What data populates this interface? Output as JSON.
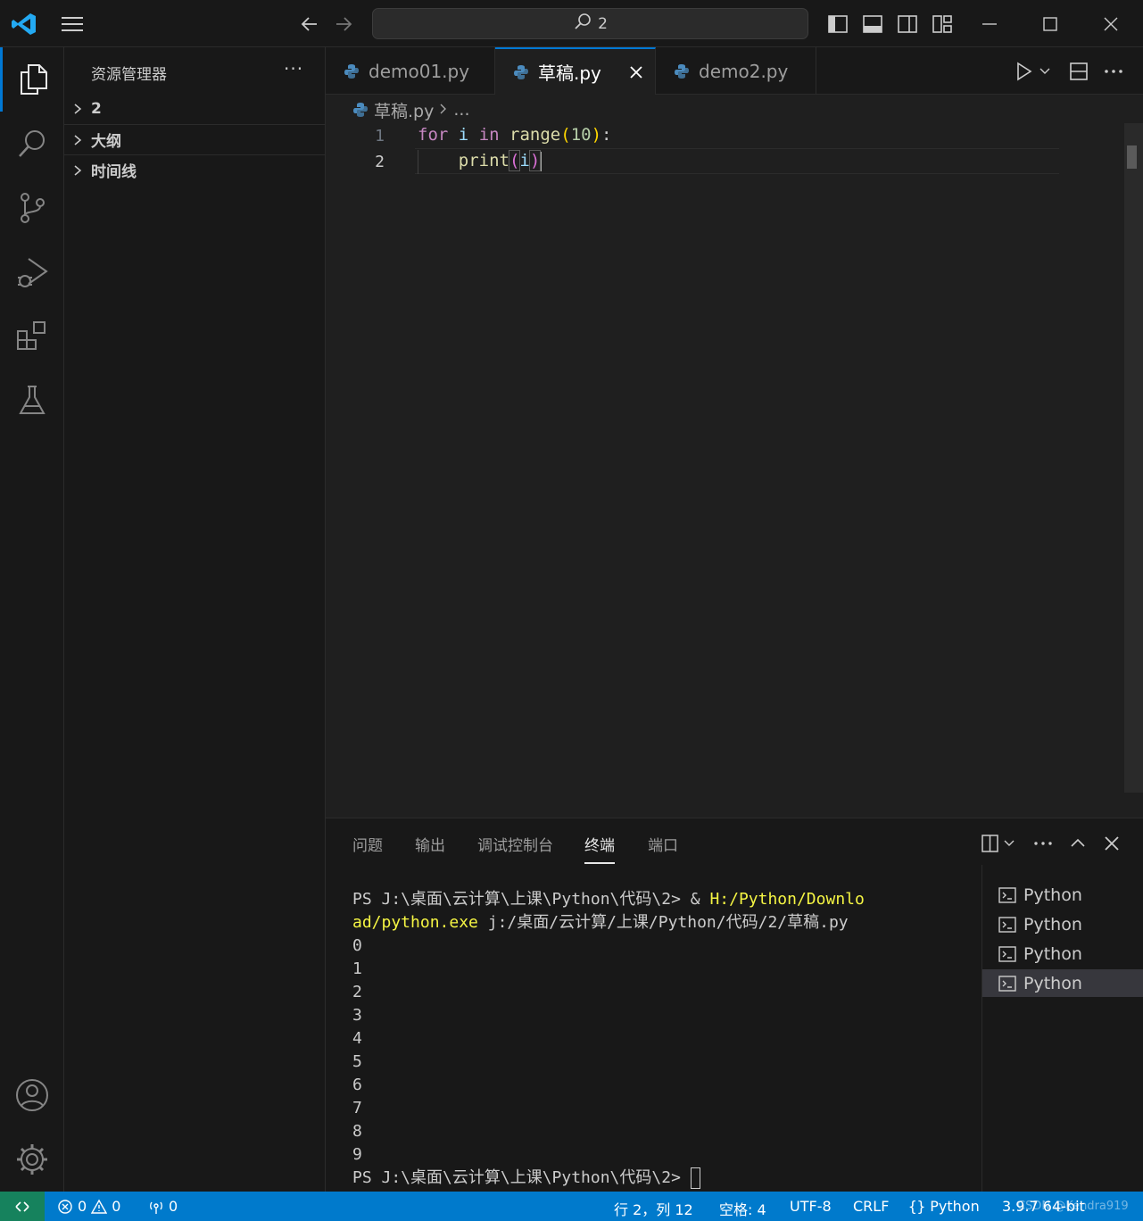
{
  "titlebar": {
    "search_text": "2"
  },
  "sidebar": {
    "title": "资源管理器",
    "more": "···",
    "sections": [
      {
        "label": "2"
      },
      {
        "label": "大纲"
      },
      {
        "label": "时间线"
      }
    ]
  },
  "tabs": [
    {
      "label": "demo01.py",
      "active": false
    },
    {
      "label": "草稿.py",
      "active": true
    },
    {
      "label": "demo2.py",
      "active": false
    }
  ],
  "breadcrumb": {
    "file": "草稿.py",
    "rest": "..."
  },
  "editor": {
    "line_numbers": [
      "1",
      "2"
    ],
    "line1": {
      "kw1": "for",
      "v1": "i",
      "kw2": "in",
      "fn": "range",
      "open": "(",
      "num": "10",
      "close": ")",
      "colon": ":"
    },
    "line2": {
      "indent": "    ",
      "fn": "print",
      "open": "(",
      "var": "i",
      "close": ")"
    }
  },
  "panel": {
    "tabs": [
      "问题",
      "输出",
      "调试控制台",
      "终端",
      "端口"
    ],
    "active_tab": "终端",
    "terminal": {
      "prompt1": "PS J:\\桌面\\云计算\\上课\\Python\\代码\\2> ",
      "amp": "& ",
      "exe_a": "H:/Python/Downlo",
      "exe_b": "ad/python.exe",
      "arg": " j:/桌面/云计算/上课/Python/代码/2/草稿.py",
      "output": [
        "0",
        "1",
        "2",
        "3",
        "4",
        "5",
        "6",
        "7",
        "8",
        "9"
      ],
      "prompt2": "PS J:\\桌面\\云计算\\上课\\Python\\代码\\2> "
    },
    "terminals": [
      {
        "label": "Python",
        "active": false
      },
      {
        "label": "Python",
        "active": false
      },
      {
        "label": "Python",
        "active": false
      },
      {
        "label": "Python",
        "active": true
      }
    ]
  },
  "statusbar": {
    "errors": "0",
    "warnings": "0",
    "ports": "0",
    "position": "行 2，列 12",
    "spaces": "空格: 4",
    "encoding": "UTF-8",
    "eol": "CRLF",
    "language": "Python",
    "interpreter": "3.9.7 64-bit",
    "watermark": "CSDN @Kendra919"
  },
  "colors": {
    "accent": "#0078d4",
    "statusbar": "#007acc",
    "remote": "#16825d"
  }
}
